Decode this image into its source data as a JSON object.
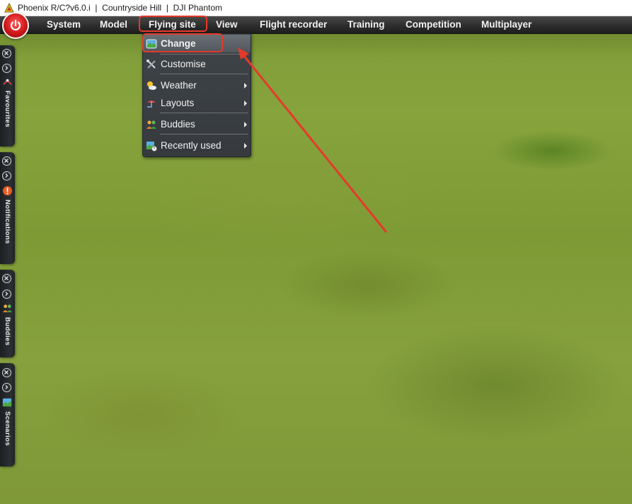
{
  "window": {
    "title": "Phoenix R/C?v6.0.i  |  Countryside Hill  |  DJI Phantom"
  },
  "menubar": {
    "items": [
      {
        "label": "System"
      },
      {
        "label": "Model"
      },
      {
        "label": "Flying site"
      },
      {
        "label": "View"
      },
      {
        "label": "Flight recorder"
      },
      {
        "label": "Training"
      },
      {
        "label": "Competition"
      },
      {
        "label": "Multiplayer"
      }
    ],
    "active_item": "Flying site"
  },
  "dropdown": {
    "items": [
      {
        "label": "Change",
        "icon": "landscape-icon",
        "submenu": false,
        "selected": true
      },
      {
        "label": "Customise",
        "icon": "tools-icon",
        "submenu": false
      },
      {
        "label": "Weather",
        "icon": "weather-icon",
        "submenu": true
      },
      {
        "label": "Layouts",
        "icon": "layouts-icon",
        "submenu": true
      },
      {
        "label": "Buddies",
        "icon": "buddies-icon",
        "submenu": true
      },
      {
        "label": "Recently used",
        "icon": "recent-icon",
        "submenu": true
      }
    ]
  },
  "side_panels": [
    {
      "label": "Favourites",
      "icon": "favourites-icon"
    },
    {
      "label": "Notifications",
      "icon": "warning-icon"
    },
    {
      "label": "Buddies",
      "icon": "buddies-icon"
    },
    {
      "label": "Scenarios",
      "icon": "scenarios-icon"
    }
  ],
  "colors": {
    "annotation": "#e53a2a",
    "menubar": "#2d2d2d",
    "dropdown": "#3a3f43",
    "power_button": "#d01818"
  }
}
